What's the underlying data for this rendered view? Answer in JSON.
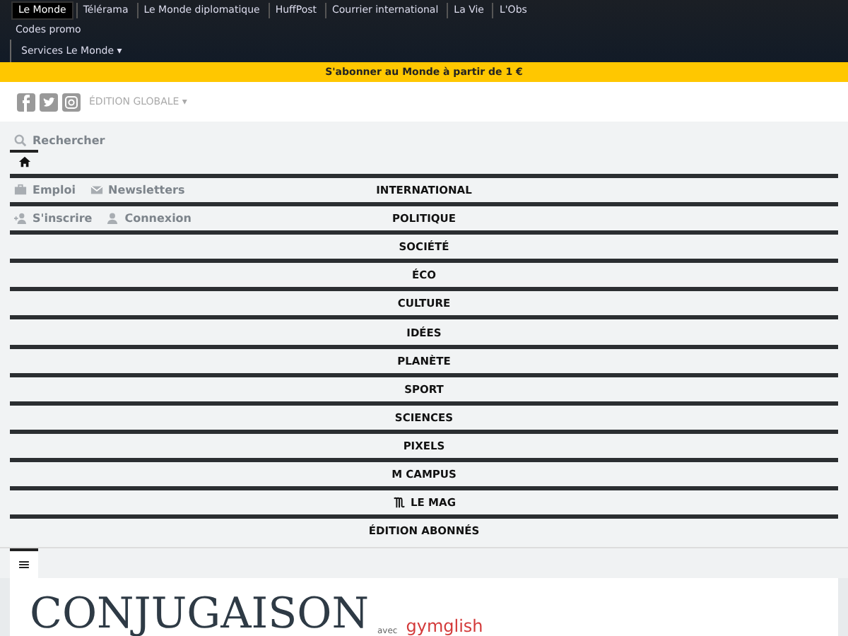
{
  "top_links": [
    {
      "label": "Le Monde",
      "selected": true
    },
    {
      "label": "Télérama",
      "selected": false
    },
    {
      "label": "Le Monde diplomatique",
      "selected": false
    },
    {
      "label": "HuffPost",
      "selected": false
    },
    {
      "label": "Courrier international",
      "selected": false
    },
    {
      "label": "La Vie",
      "selected": false
    },
    {
      "label": "L'Obs",
      "selected": false
    }
  ],
  "codes_promo": "Codes promo",
  "services_menu": "Services Le Monde ▾",
  "promo_banner": "S'abonner au Monde à partir de 1 €",
  "edition": "ÉDITION GLOBALE ▾",
  "search": "Rechercher",
  "links": [
    "Emploi",
    "Newsletters"
  ],
  "account": [
    "S'inscrire",
    "Connexion"
  ],
  "menu": [
    {
      "kind": "home"
    },
    {
      "kind": "text",
      "label": "INTERNATIONAL"
    },
    {
      "kind": "text",
      "label": "POLITIQUE"
    },
    {
      "kind": "text",
      "label": "SOCIÉTÉ"
    },
    {
      "kind": "text",
      "label": "ÉCO"
    },
    {
      "kind": "text",
      "label": "CULTURE"
    },
    {
      "kind": "text",
      "label": "IDÉES"
    },
    {
      "kind": "text",
      "label": "PLANÈTE"
    },
    {
      "kind": "text",
      "label": "SPORT"
    },
    {
      "kind": "text",
      "label": "SCIENCES"
    },
    {
      "kind": "text",
      "label": "PIXELS"
    },
    {
      "kind": "text",
      "label": "M CAMPUS"
    },
    {
      "kind": "logo",
      "label": "LE MAG"
    },
    {
      "kind": "text",
      "label": "ÉDITION ABONNÉS"
    }
  ],
  "menu_button": "≡",
  "heading": {
    "title": "CONJUGAISON",
    "with": "avec",
    "brand": "gymglish"
  }
}
